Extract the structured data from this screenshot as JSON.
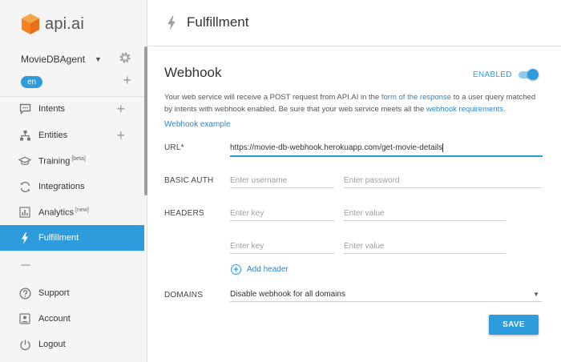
{
  "app": {
    "logo_text": "api.ai",
    "brand_color": "#f5821f",
    "accent_color": "#2e9bdc"
  },
  "sidebar": {
    "agent_name": "MovieDBAgent",
    "language": "en",
    "items": [
      {
        "label": "Intents",
        "icon": "chat-icon",
        "has_plus": true
      },
      {
        "label": "Entities",
        "icon": "hierarchy-icon",
        "has_plus": true
      },
      {
        "label": "Training",
        "badge": "[beta]",
        "icon": "graduation-icon"
      },
      {
        "label": "Integrations",
        "icon": "sync-icon"
      },
      {
        "label": "Analytics",
        "badge": "[new]",
        "icon": "bar-chart-icon"
      },
      {
        "label": "Fulfillment",
        "icon": "lightning-icon",
        "active": true
      }
    ],
    "bottom_items": [
      {
        "label": "Support",
        "icon": "help-icon"
      },
      {
        "label": "Account",
        "icon": "person-icon"
      },
      {
        "label": "Logout",
        "icon": "power-icon"
      }
    ]
  },
  "header": {
    "title": "Fulfillment"
  },
  "webhook": {
    "title": "Webhook",
    "status_label": "ENABLED",
    "enabled": true,
    "desc_part1": "Your web service will receive a POST request from API.AI in the ",
    "desc_link1": "form of the response",
    "desc_part2": " to a user query matched by intents with webhook enabled. Be sure that your web service meets all the ",
    "desc_link2": "webhook requirements",
    "desc_part3": ".",
    "example_link": "Webhook example",
    "url_label": "URL*",
    "url_value": "https://movie-db-webhook.herokuapp.com/get-movie-details",
    "basic_auth_label": "BASIC AUTH",
    "username_placeholder": "Enter username",
    "password_placeholder": "Enter password",
    "headers_label": "HEADERS",
    "key_placeholder": "Enter key",
    "value_placeholder": "Enter value",
    "add_header_label": "Add header",
    "domains_label": "DOMAINS",
    "domains_value": "Disable webhook for all domains",
    "save_label": "SAVE"
  }
}
